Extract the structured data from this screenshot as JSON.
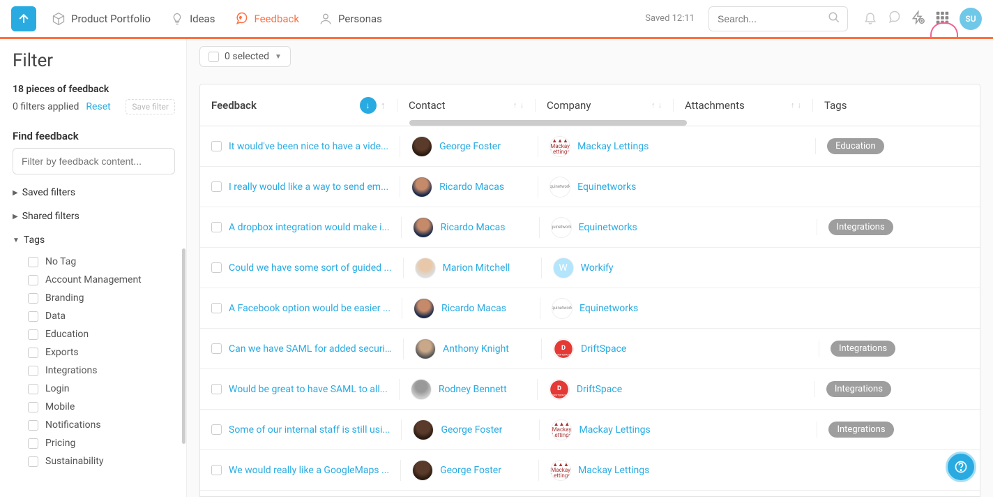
{
  "nav": {
    "items": [
      {
        "label": "Product Portfolio",
        "icon": "cube"
      },
      {
        "label": "Ideas",
        "icon": "bulb"
      },
      {
        "label": "Feedback",
        "icon": "heart-chat",
        "active": true
      },
      {
        "label": "Personas",
        "icon": "persona"
      }
    ]
  },
  "header": {
    "saved_text": "Saved 12:11",
    "search_placeholder": "Search...",
    "avatar_initials": "SU"
  },
  "sidebar": {
    "title": "Filter",
    "count_line": "18 pieces of feedback",
    "applied_line": "0 filters applied",
    "reset": "Reset",
    "save_filter": "Save filter",
    "find_label": "Find feedback",
    "filter_placeholder": "Filter by feedback content...",
    "saved_filters": "Saved filters",
    "shared_filters": "Shared filters",
    "tags_label": "Tags",
    "tags": [
      "No Tag",
      "Account Management",
      "Branding",
      "Data",
      "Education",
      "Exports",
      "Integrations",
      "Login",
      "Mobile",
      "Notifications",
      "Pricing",
      "Sustainability"
    ]
  },
  "toolbar": {
    "selected_text": "0 selected"
  },
  "columns": {
    "feedback": "Feedback",
    "contact": "Contact",
    "company": "Company",
    "attachments": "Attachments",
    "tags": "Tags"
  },
  "rows": [
    {
      "feedback": "It would've been nice to have a vide...",
      "contact": "George Foster",
      "company": "Mackay Lettings",
      "ctype": "mackay",
      "ptype": "p1",
      "tags": [
        "Education"
      ]
    },
    {
      "feedback": "I really would like a way to send em...",
      "contact": "Ricardo Macas",
      "company": "Equinetworks",
      "ctype": "equi",
      "ptype": "p2",
      "tags": []
    },
    {
      "feedback": "A dropbox integration would make i...",
      "contact": "Ricardo Macas",
      "company": "Equinetworks",
      "ctype": "equi",
      "ptype": "p2",
      "tags": [
        "Integrations"
      ]
    },
    {
      "feedback": "Could we have some sort of guided ...",
      "contact": "Marion Mitchell",
      "company": "Workify",
      "ctype": "workify",
      "ptype": "p3",
      "tags": []
    },
    {
      "feedback": "A Facebook option would be easier ...",
      "contact": "Ricardo Macas",
      "company": "Equinetworks",
      "ctype": "equi",
      "ptype": "p2",
      "tags": []
    },
    {
      "feedback": "Can we have SAML for added securi...",
      "contact": "Anthony Knight",
      "company": "DriftSpace",
      "ctype": "drift",
      "ptype": "p4",
      "tags": [
        "Integrations"
      ]
    },
    {
      "feedback": "Would be great to have SAML to all...",
      "contact": "Rodney Bennett",
      "company": "DriftSpace",
      "ctype": "drift",
      "ptype": "p5",
      "tags": [
        "Integrations"
      ]
    },
    {
      "feedback": "Some of our internal staff is still usi...",
      "contact": "George Foster",
      "company": "Mackay Lettings",
      "ctype": "mackay",
      "ptype": "p1",
      "tags": [
        "Integrations"
      ]
    },
    {
      "feedback": "We would really like a GoogleMaps ...",
      "contact": "George Foster",
      "company": "Mackay Lettings",
      "ctype": "mackay",
      "ptype": "p1",
      "tags": []
    }
  ]
}
